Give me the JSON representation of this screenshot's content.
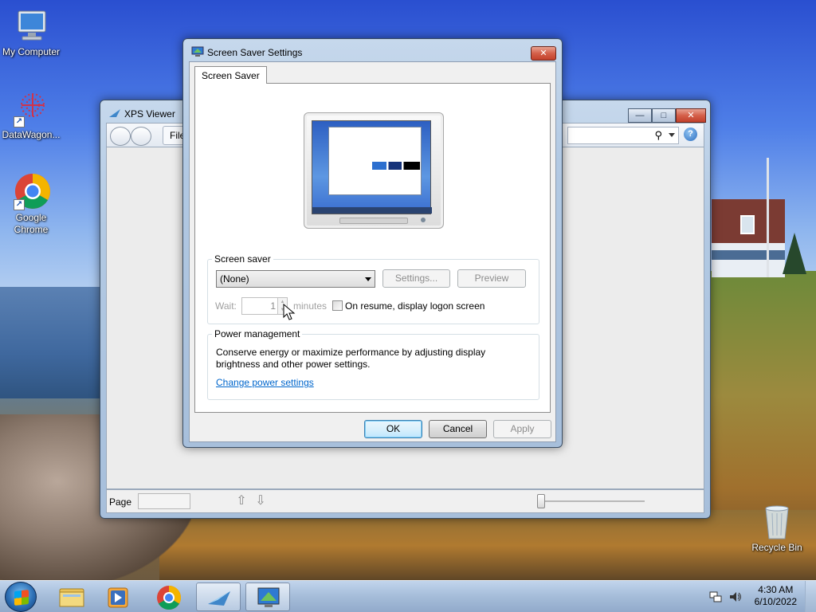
{
  "desktop": {
    "icons": [
      {
        "label": "My Computer",
        "icon": "computer-icon"
      },
      {
        "label": "DataWagon...",
        "icon": "datawagon-icon"
      },
      {
        "label": "Google Chrome",
        "icon": "chrome-icon"
      },
      {
        "label": "Recycle Bin",
        "icon": "recycle-bin-icon"
      }
    ]
  },
  "xps_viewer": {
    "title": "XPS Viewer",
    "file_menu": "File",
    "status_page_label": "Page",
    "window_buttons": {
      "minimize": "—",
      "maximize": "□",
      "close": "✕"
    },
    "search_icon": "search-icon",
    "help_icon": "help-icon"
  },
  "screensaver_dialog": {
    "title": "Screen Saver Settings",
    "close_glyph": "✕",
    "tab_label": "Screen Saver",
    "screen_saver_group": {
      "legend": "Screen saver",
      "selected_saver": "(None)",
      "settings_button": "Settings...",
      "preview_button": "Preview",
      "wait_label": "Wait:",
      "wait_value": "1",
      "minutes_label": "minutes",
      "resume_checkbox_label": "On resume, display logon screen",
      "resume_checked": false
    },
    "power_group": {
      "legend": "Power management",
      "description_line1": "Conserve energy or maximize performance by adjusting display",
      "description_line2": "brightness and other power settings.",
      "link": "Change power settings"
    },
    "buttons": {
      "ok": "OK",
      "cancel": "Cancel",
      "apply": "Apply"
    }
  },
  "taskbar": {
    "pinned": [
      "start-orb",
      "file-explorer-icon",
      "media-player-icon",
      "chrome-icon",
      "xps-viewer-icon",
      "screen-saver-icon"
    ],
    "clock_time": "4:30 AM",
    "clock_date": "6/10/2022"
  }
}
